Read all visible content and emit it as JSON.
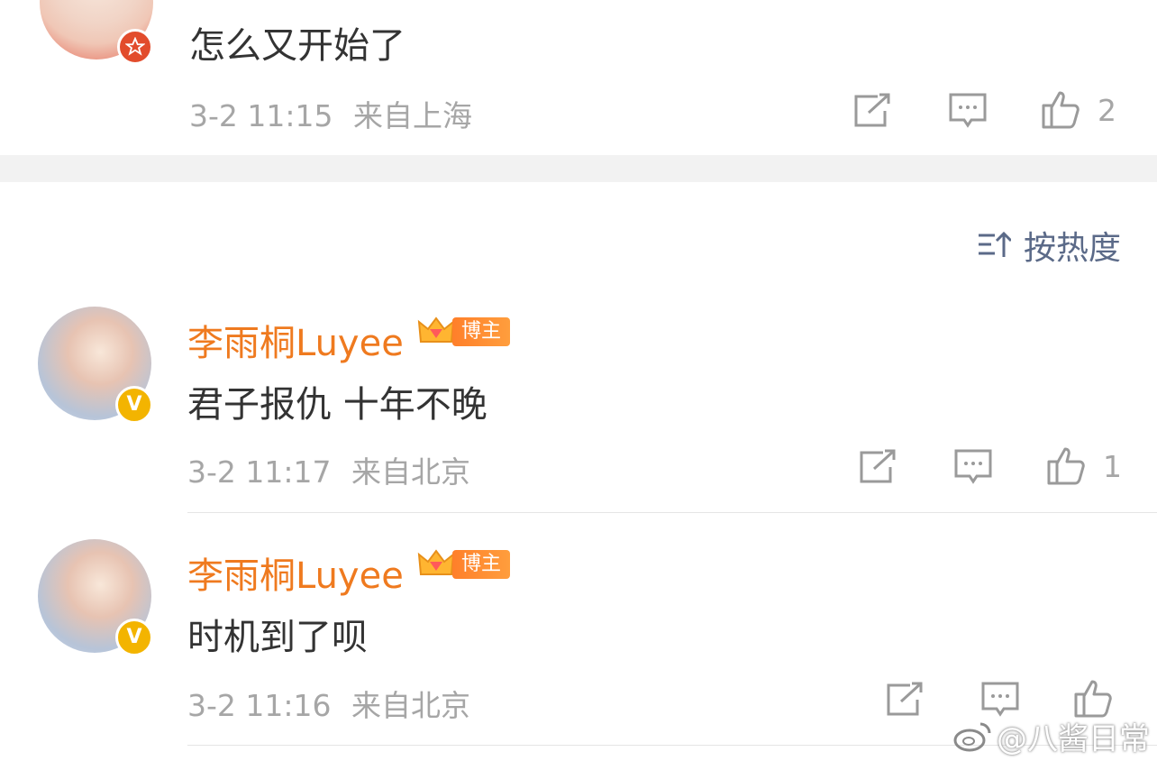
{
  "comments": [
    {
      "content": "怎么又开始了",
      "time": "3-2 11:15",
      "location": "来自上海",
      "likes": "2"
    },
    {
      "username": "李雨桐Luyee",
      "badge": "博主",
      "content": "君子报仇 十年不晚",
      "time": "3-2 11:17",
      "location": "来自北京",
      "likes": "1"
    },
    {
      "username": "李雨桐Luyee",
      "badge": "博主",
      "content": "时机到了呗",
      "time": "3-2 11:16",
      "location": "来自北京"
    }
  ],
  "sort": {
    "label": "按热度"
  },
  "watermark": {
    "text": "@八酱日常"
  },
  "colors": {
    "username": "#ef7a1f",
    "meta": "#a6a6a6",
    "sort": "#5b6a88",
    "badge_v": "#f3b400"
  }
}
